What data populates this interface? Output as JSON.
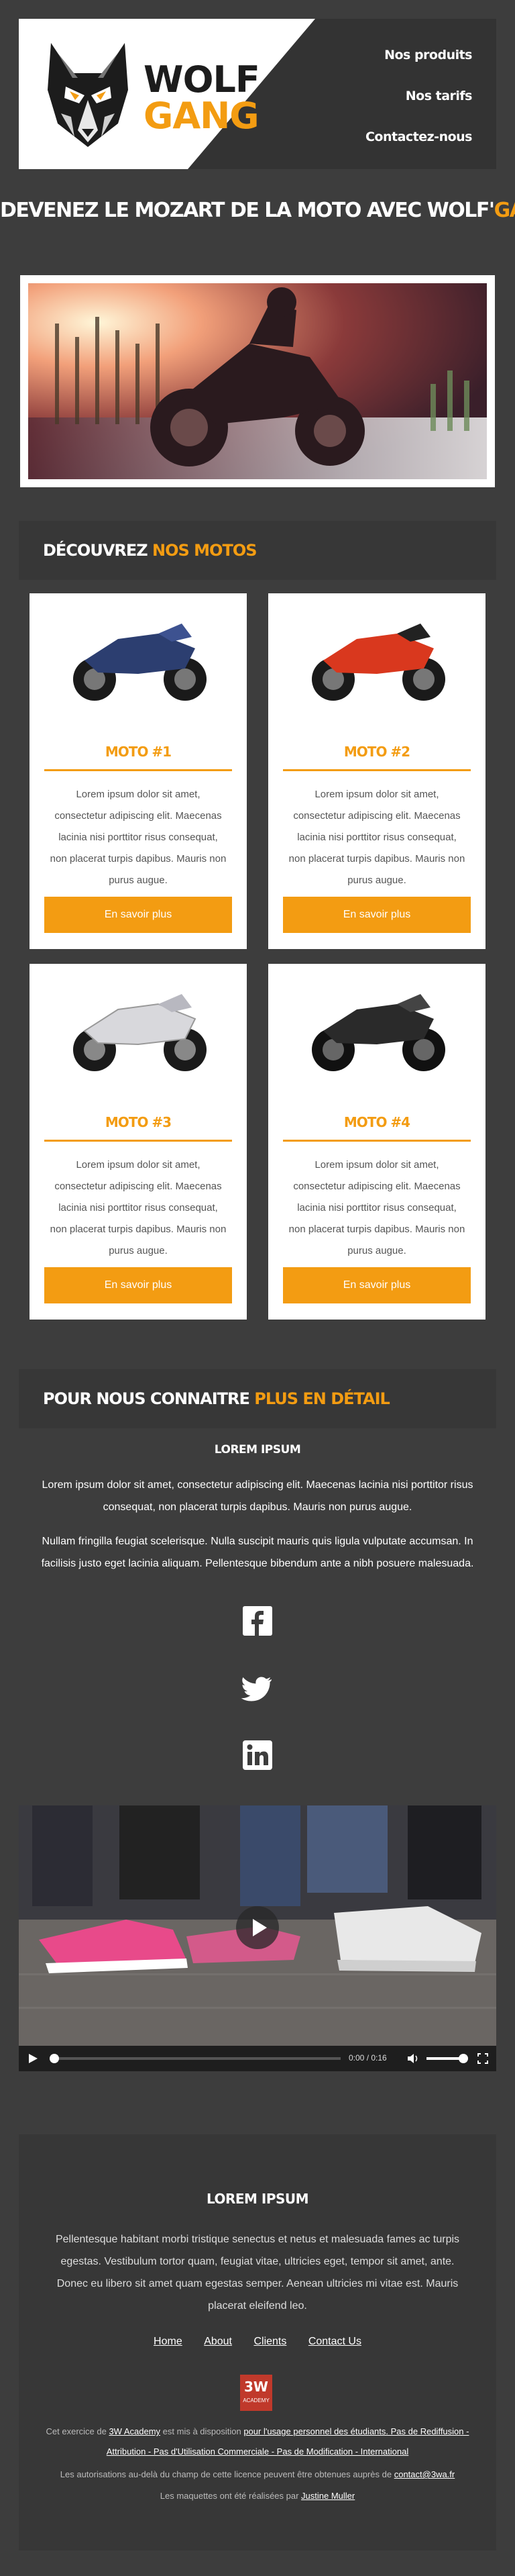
{
  "brand": {
    "word1": "WOLF",
    "word2": "GANG",
    "accent_color": "#f39c12"
  },
  "nav": {
    "items": [
      "Nos produits",
      "Nos tarifs",
      "Contactez-nous"
    ]
  },
  "hero": {
    "title_pre": "DEVENEZ LE MOZART DE LA MOTO AVEC WOLF'",
    "title_accent": "GANG",
    "title_post": " !"
  },
  "products": {
    "heading_pre": "DÉCOUVREZ ",
    "heading_accent": "NOS MOTOS",
    "cards": [
      {
        "title": "MOTO #1",
        "text": "Lorem ipsum dolor sit amet, consectetur adipiscing elit. Maecenas lacinia nisi porttitor risus consequat, non placerat turpis dapibus. Mauris non purus augue.",
        "button": "En savoir plus",
        "color": "#2c3e70"
      },
      {
        "title": "MOTO #2",
        "text": "Lorem ipsum dolor sit amet, consectetur adipiscing elit. Maecenas lacinia nisi porttitor risus consequat, non placerat turpis dapibus. Mauris non purus augue.",
        "button": "En savoir plus",
        "color": "#d9381e"
      },
      {
        "title": "MOTO #3",
        "text": "Lorem ipsum dolor sit amet, consectetur adipiscing elit. Maecenas lacinia nisi porttitor risus consequat, non placerat turpis dapibus. Mauris non purus augue.",
        "button": "En savoir plus",
        "color": "#d8d8dc"
      },
      {
        "title": "MOTO #4",
        "text": "Lorem ipsum dolor sit amet, consectetur adipiscing elit. Maecenas lacinia nisi porttitor risus consequat, non placerat turpis dapibus. Mauris non purus augue.",
        "button": "En savoir plus",
        "color": "#2a2a2a"
      }
    ]
  },
  "about": {
    "heading_pre": "POUR NOUS CONNAITRE ",
    "heading_accent": "PLUS EN DÉTAIL",
    "subtitle": "LOREM IPSUM",
    "p1": "Lorem ipsum dolor sit amet, consectetur adipiscing elit. Maecenas lacinia nisi porttitor risus consequat, non placerat turpis dapibus. Mauris non purus augue.",
    "p2": "Nullam fringilla feugiat scelerisque. Nulla suscipit mauris quis ligula vulputate accumsan. In facilisis justo eget lacinia aliquam. Pellentesque bibendum ante a nibh posuere malesuada.",
    "social": [
      "facebook-icon",
      "twitter-icon",
      "linkedin-icon"
    ]
  },
  "video": {
    "time": "0:00 / 0:16"
  },
  "footer": {
    "title": "LOREM IPSUM",
    "text": "Pellentesque habitant morbi tristique senectus et netus et malesuada fames ac turpis egestas. Vestibulum tortor quam, feugiat vitae, ultricies eget, tempor sit amet, ante. Donec eu libero sit amet quam egestas semper. Aenean ultricies mi vitae est. Mauris placerat eleifend leo.",
    "links": [
      "Home",
      "About",
      "Clients",
      "Contact Us"
    ],
    "badge": "3W",
    "badge_sub": "ACADEMY",
    "legal1_a": "Cet exercice de ",
    "legal1_link1": "3W Academy",
    "legal1_b": " est mis à disposition ",
    "legal1_link2": "pour l'usage personnel des étudiants. Pas de Rediffusion - Attribution - Pas d'Utilisation Commerciale - Pas de Modification - International",
    "legal2_a": "Les autorisations au-delà du champ de cette licence peuvent être obtenues auprès de ",
    "legal2_link": "contact@3wa.fr",
    "legal3_a": "Les maquettes ont été réalisées par ",
    "legal3_link": "Justine Muller"
  }
}
